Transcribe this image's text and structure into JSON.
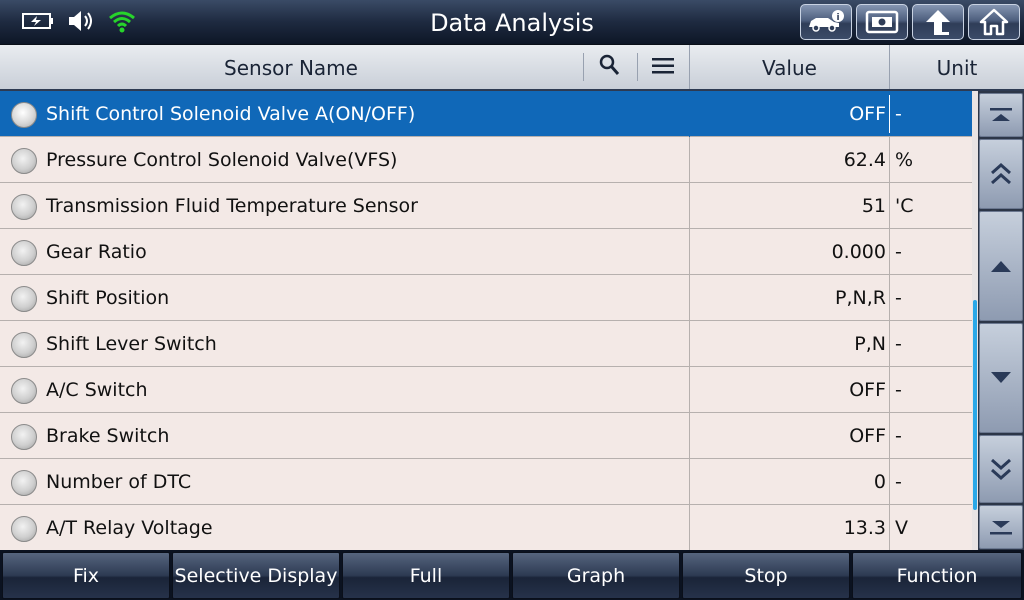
{
  "header": {
    "title": "Data Analysis",
    "status_icons": [
      "battery-charging-icon",
      "speaker-icon",
      "wifi-icon"
    ],
    "buttons": [
      "vehicle-info-icon",
      "screenshot-icon",
      "back-up-arrow-icon",
      "home-icon"
    ]
  },
  "table": {
    "columns": {
      "name": "Sensor Name",
      "value": "Value",
      "unit": "Unit"
    },
    "rows": [
      {
        "name": "Shift Control Solenoid Valve A(ON/OFF)",
        "value": "OFF",
        "unit": "-",
        "selected": true
      },
      {
        "name": "Pressure Control Solenoid Valve(VFS)",
        "value": "62.4",
        "unit": "%"
      },
      {
        "name": "Transmission Fluid Temperature Sensor",
        "value": "51",
        "unit": "'C"
      },
      {
        "name": "Gear Ratio",
        "value": "0.000",
        "unit": "-"
      },
      {
        "name": "Shift Position",
        "value": "P,N,R",
        "unit": "-"
      },
      {
        "name": "Shift Lever Switch",
        "value": "P,N",
        "unit": "-"
      },
      {
        "name": "A/C Switch",
        "value": "OFF",
        "unit": "-"
      },
      {
        "name": "Brake Switch",
        "value": "OFF",
        "unit": "-"
      },
      {
        "name": "Number of DTC",
        "value": "0",
        "unit": "-"
      },
      {
        "name": "A/T Relay Voltage",
        "value": "13.3",
        "unit": "V"
      }
    ]
  },
  "scroll_buttons": [
    "scroll-top-icon",
    "page-up-icon",
    "line-up-icon",
    "line-down-icon",
    "page-down-icon",
    "scroll-bottom-icon"
  ],
  "footer": {
    "fix": "Fix",
    "selective_display": "Selective Display",
    "full": "Full",
    "graph": "Graph",
    "stop": "Stop",
    "function": "Function"
  },
  "colors": {
    "selected_row": "#1068b8",
    "row_bg": "#f3e9e6",
    "title_bar": "#1e2a40",
    "scroll_indicator": "#2aa8e8"
  }
}
